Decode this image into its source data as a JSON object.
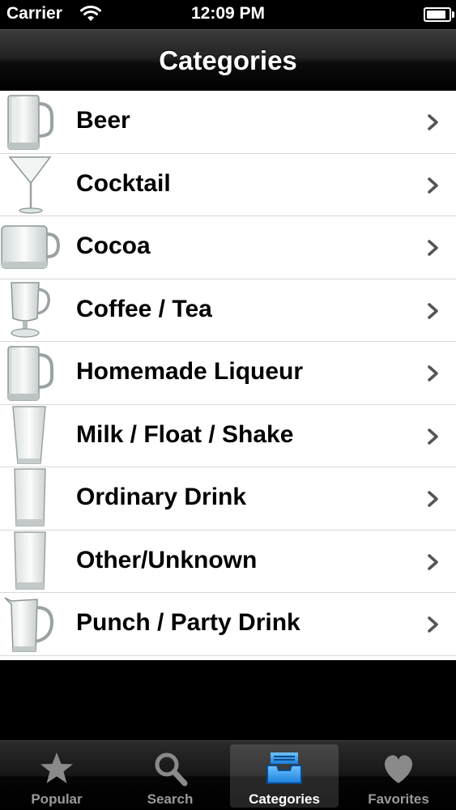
{
  "status_bar": {
    "carrier": "Carrier",
    "time": "12:09 PM",
    "wifi_icon": "wifi-icon",
    "battery_icon": "battery-icon",
    "battery_level": 0.9
  },
  "nav": {
    "title": "Categories"
  },
  "categories": [
    {
      "label": "Beer",
      "icon": "beer-mug-icon"
    },
    {
      "label": "Cocktail",
      "icon": "martini-glass-icon"
    },
    {
      "label": "Cocoa",
      "icon": "cocoa-mug-icon"
    },
    {
      "label": "Coffee / Tea",
      "icon": "irish-coffee-mug-icon"
    },
    {
      "label": "Homemade Liqueur",
      "icon": "beer-mug-icon"
    },
    {
      "label": "Milk / Float / Shake",
      "icon": "tall-glass-icon"
    },
    {
      "label": "Ordinary Drink",
      "icon": "highball-glass-icon"
    },
    {
      "label": "Other/Unknown",
      "icon": "highball-glass-icon"
    },
    {
      "label": "Punch / Party Drink",
      "icon": "pitcher-icon"
    }
  ],
  "tab_bar": {
    "tabs": [
      {
        "label": "Popular",
        "icon": "star-icon",
        "selected": false
      },
      {
        "label": "Search",
        "icon": "magnifier-icon",
        "selected": false
      },
      {
        "label": "Categories",
        "icon": "inbox-tray-icon",
        "selected": true
      },
      {
        "label": "Favorites",
        "icon": "heart-icon",
        "selected": false
      }
    ]
  },
  "colors": {
    "accent_blue": "#2a8be8",
    "tab_inactive": "#9a9a9a",
    "separator": "#d9d9d9"
  }
}
